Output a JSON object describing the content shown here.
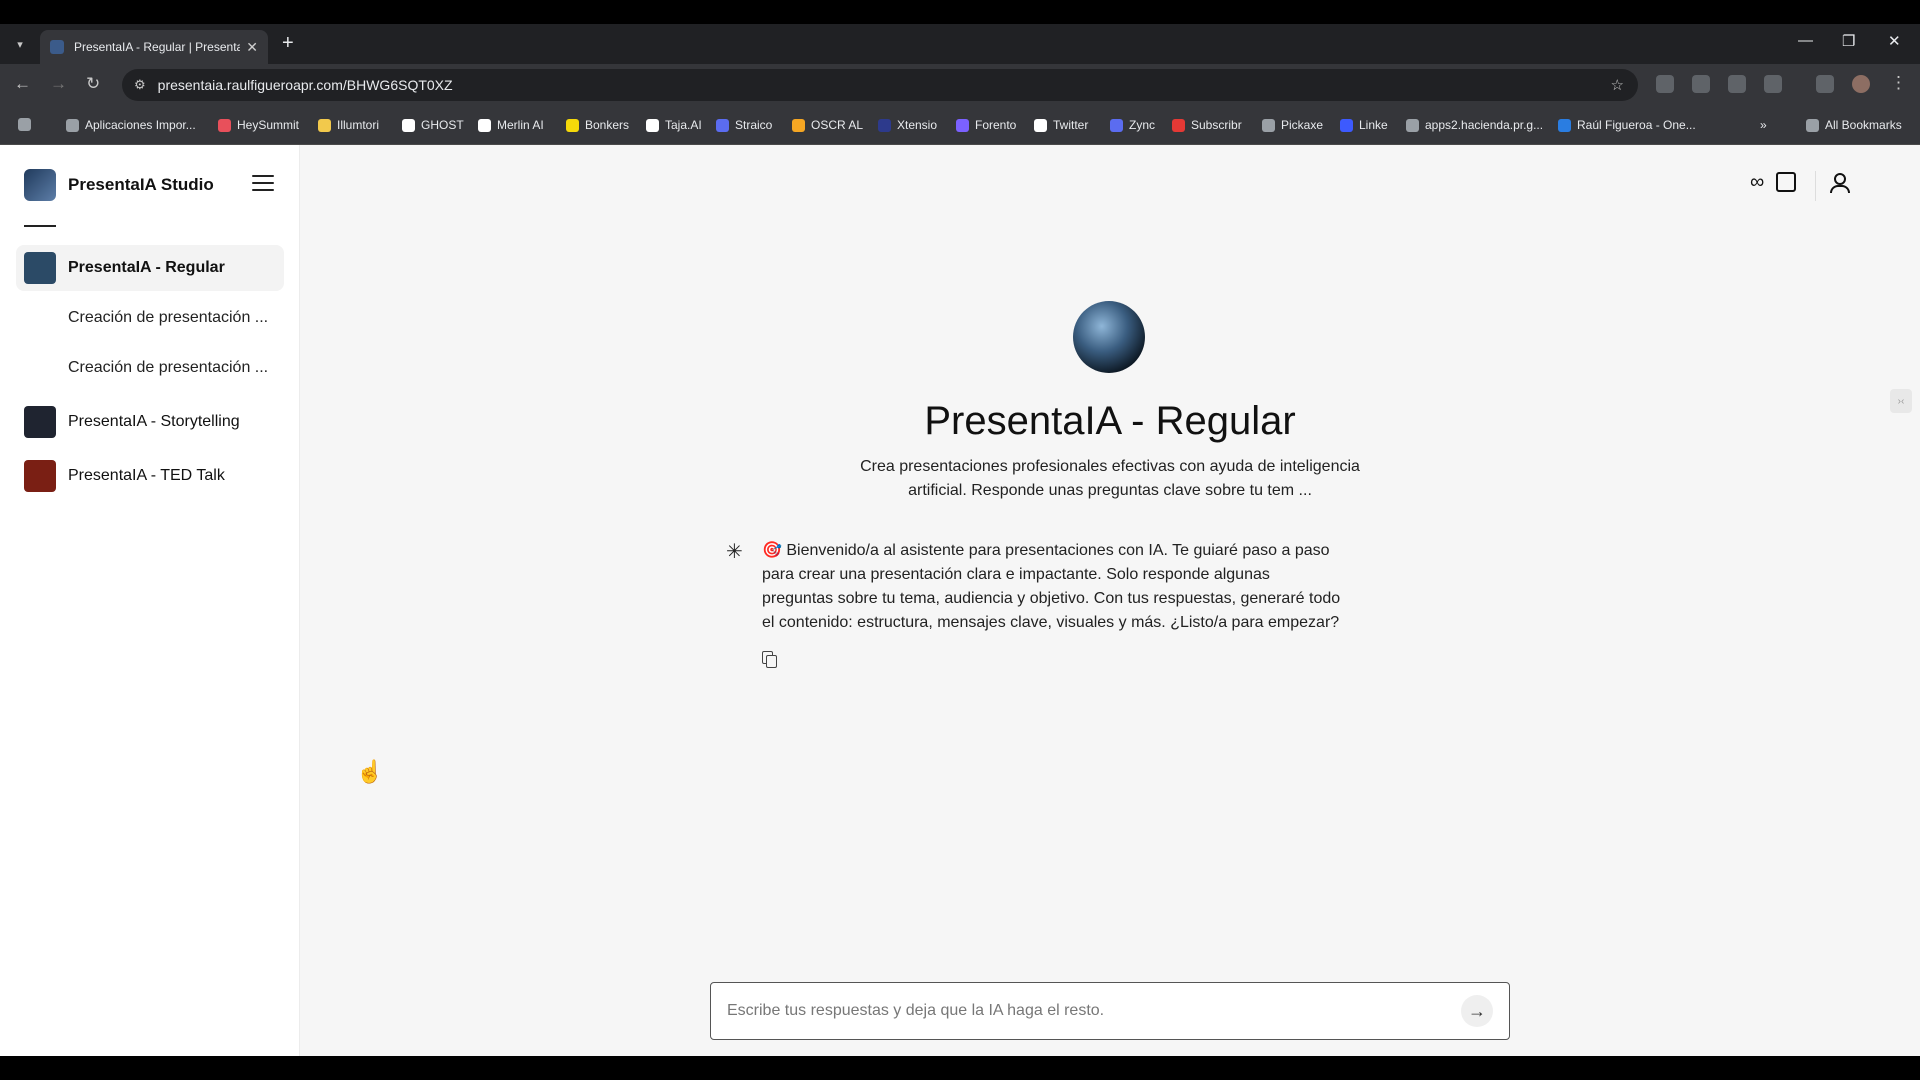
{
  "browser": {
    "tab_title": "PresentaIA - Regular | Presenta",
    "tab_close": "✕",
    "new_tab": "+",
    "url": "presentaia.raulfigueroapr.com/BHWG6SQT0XZ",
    "bookmarks": [
      {
        "label": "Aplicaciones Impor...",
        "color": "#9aa0a6"
      },
      {
        "label": "HeySummit",
        "color": "#e8505b"
      },
      {
        "label": "Illumtori",
        "color": "#f2c94c"
      },
      {
        "label": "GHOST",
        "color": "#ffffff"
      },
      {
        "label": "Merlin AI",
        "color": "#ffffff"
      },
      {
        "label": "Bonkers",
        "color": "#f5d90a"
      },
      {
        "label": "Taja.AI",
        "color": "#ffffff"
      },
      {
        "label": "Straico",
        "color": "#5b6cf0"
      },
      {
        "label": "OSCR AL",
        "color": "#f5a623"
      },
      {
        "label": "Xtensio",
        "color": "#2d3a8c"
      },
      {
        "label": "Forento",
        "color": "#7b61ff"
      },
      {
        "label": "Twitter",
        "color": "#ffffff"
      },
      {
        "label": "Zync",
        "color": "#5b6cf0"
      },
      {
        "label": "Subscribr",
        "color": "#e53935"
      },
      {
        "label": "Pickaxe",
        "color": "#9aa0a6"
      },
      {
        "label": "Linke",
        "color": "#3d5afe"
      },
      {
        "label": "apps2.hacienda.pr.g...",
        "color": "#9aa0a6"
      },
      {
        "label": "Raúl Figueroa - One...",
        "color": "#2a7de1"
      }
    ],
    "all_bookmarks": "All Bookmarks"
  },
  "sidebar": {
    "brand": "PresentaIA Studio",
    "items": [
      {
        "label": "PresentaIA - Regular",
        "active": true,
        "thumb": "#2b4a66"
      },
      {
        "label": "Creación de presentación ..."
      },
      {
        "label": "Creación de presentación ..."
      },
      {
        "label": "PresentaIA - Storytelling",
        "thumb": "#1f2430"
      },
      {
        "label": "PresentaIA - TED Talk",
        "thumb": "#7a1f14"
      }
    ]
  },
  "main": {
    "title": "PresentaIA - Regular",
    "description": "Crea presentaciones profesionales efectivas con ayuda de inteligencia artificial. Responde unas preguntas clave sobre tu tem ...",
    "message": "🎯 Bienvenido/a al asistente para presentaciones con IA. Te guiaré paso a paso para crear una presentación clara e impactante. Solo responde algunas preguntas sobre tu tema, audiencia y objetivo. Con tus respuestas, generaré todo el contenido: estructura, mensajes clave, visuales y más. ¿Listo/a para empezar?",
    "input_placeholder": "Escribe tus respuestas y deja que la IA haga el resto."
  },
  "icons": {
    "infinity": "∞",
    "send": "→"
  }
}
